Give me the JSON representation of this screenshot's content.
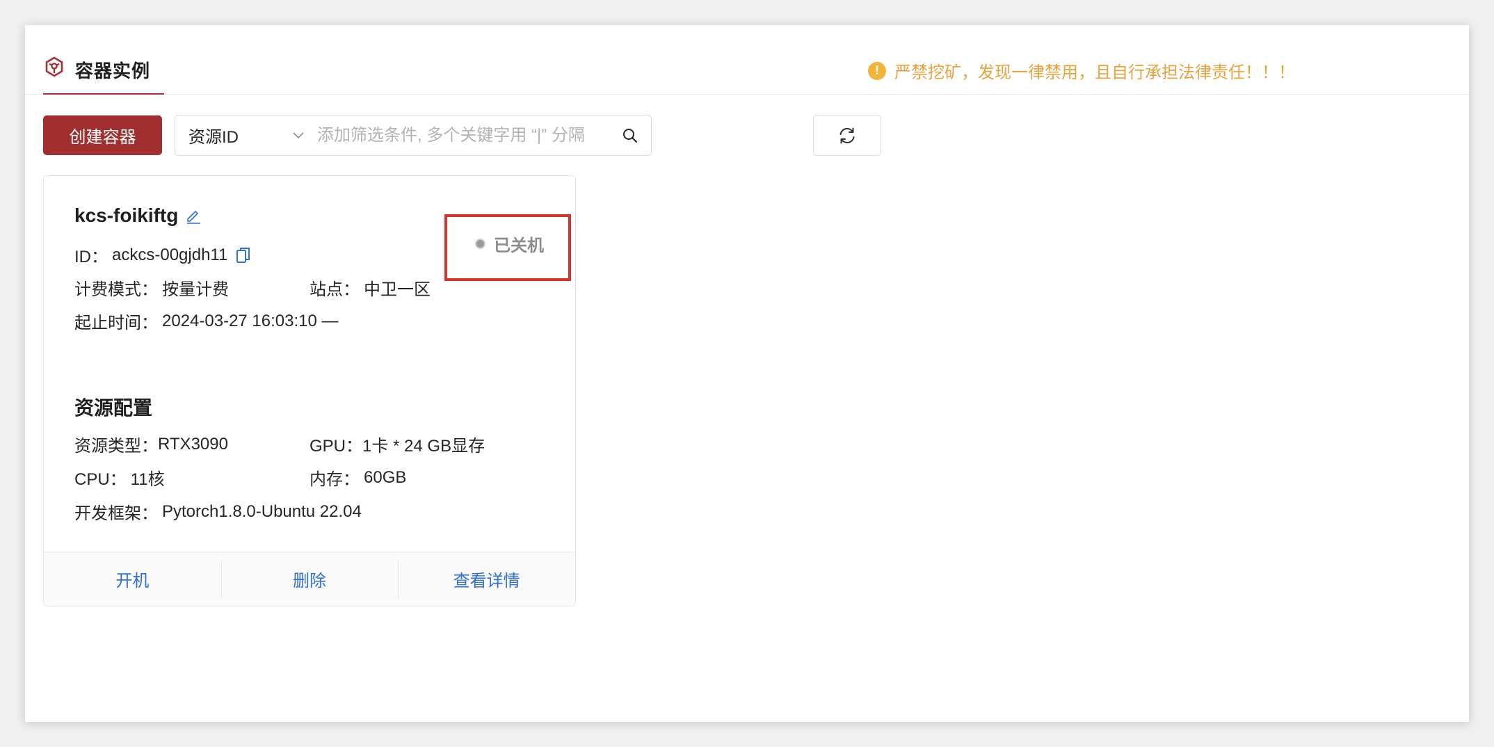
{
  "header": {
    "title": "容器实例",
    "warning": "严禁挖矿，发现一律禁用，且自行承担法律责任！！！"
  },
  "toolbar": {
    "create_label": "创建容器",
    "filter_field": "资源ID",
    "search_placeholder": "添加筛选条件, 多个关键字用 “|” 分隔"
  },
  "instance": {
    "name": "kcs-foikiftg",
    "status": "已关机",
    "id_label": "ID：",
    "id": "ackcs-00gjdh11",
    "billing_label": "计费模式：",
    "billing": "按量计费",
    "site_label": "站点：",
    "site": "中卫一区",
    "time_label": "起止时间：",
    "time": "2024-03-27 16:03:10 —",
    "resource_title": "资源配置",
    "resource_type_label": "资源类型：",
    "resource_type": "RTX3090",
    "gpu_label": "GPU：",
    "gpu": "1卡 * 24 GB显存",
    "cpu_label": "CPU：",
    "cpu": "11核",
    "memory_label": "内存：",
    "memory": "60GB",
    "framework_label": "开发框架：",
    "framework": "Pytorch1.8.0-Ubuntu 22.04"
  },
  "actions": {
    "start": "开机",
    "delete": "删除",
    "details": "查看详情"
  },
  "colors": {
    "brand": "#a12f2f",
    "warning": "#e8a33d",
    "link": "#2f6fd6",
    "highlight": "#d7322b"
  }
}
